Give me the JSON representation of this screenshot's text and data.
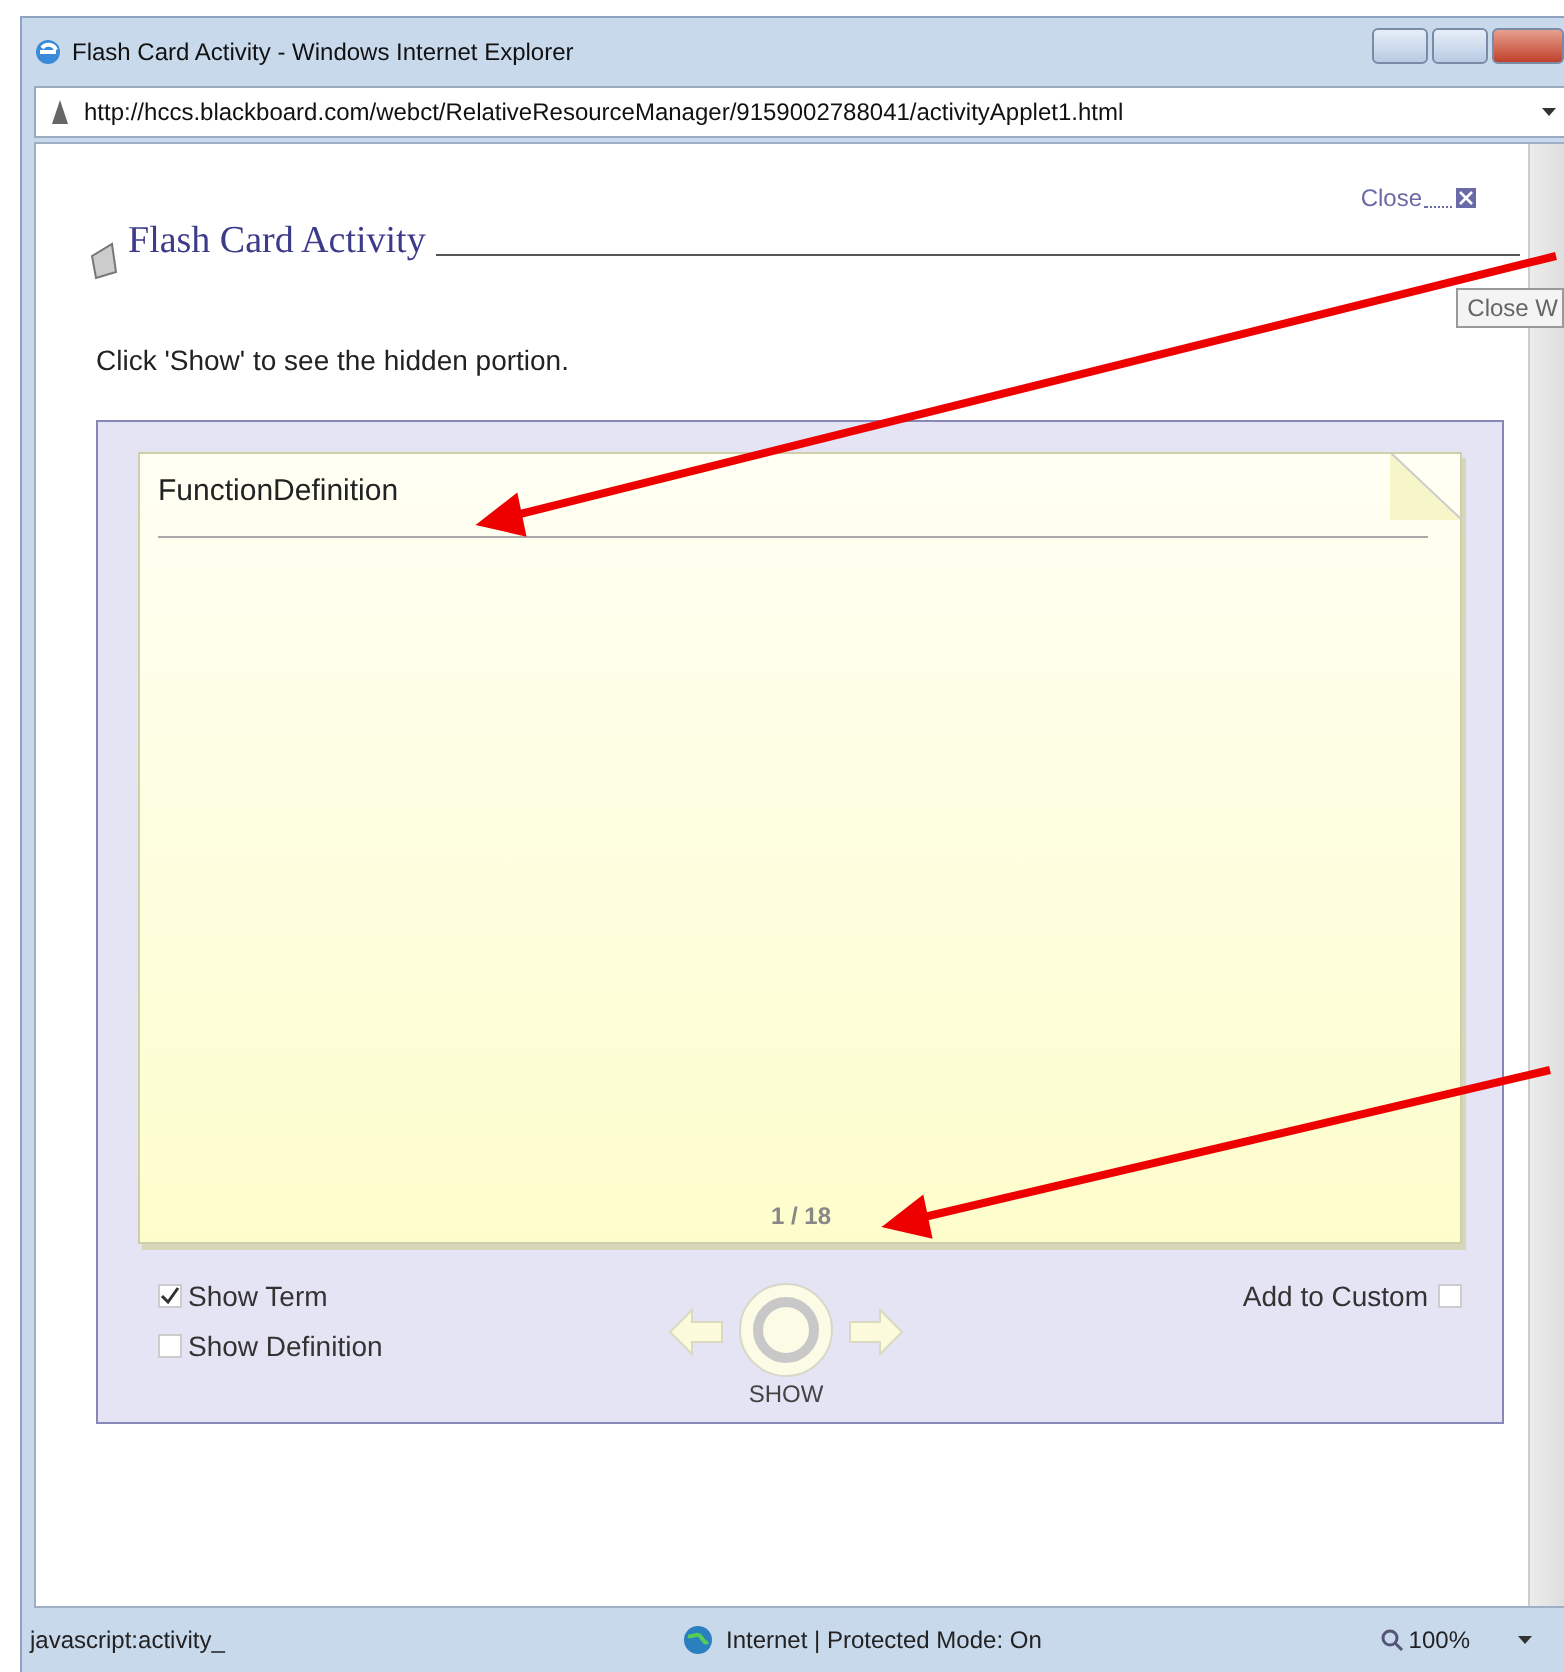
{
  "window": {
    "title": "Flash Card Activity - Windows Internet Explorer"
  },
  "address": {
    "url": "http://hccs.blackboard.com/webct/RelativeResourceManager/9159002788041/activityApplet1.html"
  },
  "close_link": {
    "label": "Close"
  },
  "tooltip": {
    "text": "Close W"
  },
  "heading": "Flash Card Activity",
  "instruction": "Click 'Show' to see the hidden portion.",
  "card": {
    "term": "FunctionDefinition",
    "counter": "1 / 18"
  },
  "options": [
    {
      "label": "Show Term",
      "checked": true
    },
    {
      "label": "Show Definition",
      "checked": false
    }
  ],
  "show_button": {
    "label": "SHOW"
  },
  "add_to_custom": {
    "label": "Add to Custom",
    "checked": false
  },
  "status_bar": {
    "left": "javascript:activity_",
    "zone": "Internet | Protected Mode: On",
    "zoom": "100%"
  }
}
